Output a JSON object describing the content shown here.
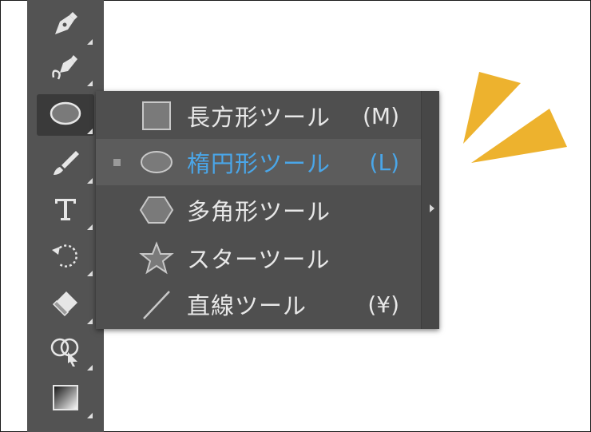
{
  "colors": {
    "toolbar_bg": "#535353",
    "menu_bg": "#4f4f4f",
    "active_text": "#4aa6e8",
    "burst": "#edb22e"
  },
  "toolbar": {
    "tools": [
      {
        "name": "pen-tool",
        "icon": "pen-icon"
      },
      {
        "name": "curvature-tool",
        "icon": "curvature-pen-icon"
      },
      {
        "name": "ellipse-tool",
        "icon": "ellipse-icon",
        "selected": true
      },
      {
        "name": "paintbrush-tool",
        "icon": "brush-icon"
      },
      {
        "name": "type-tool",
        "icon": "type-icon"
      },
      {
        "name": "rotate-tool",
        "icon": "rotate-icon"
      },
      {
        "name": "eraser-tool",
        "icon": "eraser-icon"
      },
      {
        "name": "shape-builder-tool",
        "icon": "shape-builder-icon"
      },
      {
        "name": "gradient-tool",
        "icon": "gradient-icon"
      }
    ]
  },
  "flyout": {
    "items": [
      {
        "label": "長方形ツール",
        "shortcut": "(M)",
        "icon": "rectangle-icon",
        "active": false
      },
      {
        "label": "楕円形ツール",
        "shortcut": "(L)",
        "icon": "ellipse-icon",
        "active": true
      },
      {
        "label": "多角形ツール",
        "shortcut": "",
        "icon": "polygon-icon",
        "active": false
      },
      {
        "label": "スターツール",
        "shortcut": "",
        "icon": "star-icon",
        "active": false
      },
      {
        "label": "直線ツール",
        "shortcut": "(¥)",
        "icon": "line-icon",
        "active": false
      }
    ]
  }
}
